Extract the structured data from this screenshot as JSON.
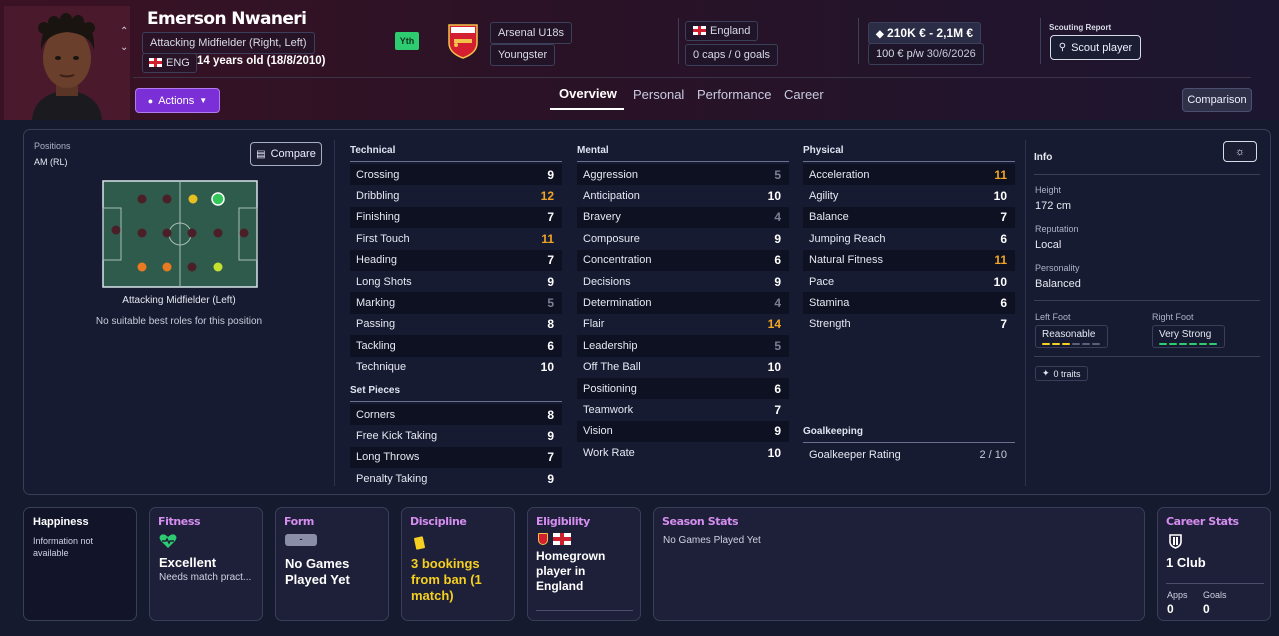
{
  "player": {
    "name": "Emerson Nwaneri",
    "position": "Attacking Midfielder (Right, Left)",
    "nation_code": "ENG",
    "age": "14 years old (18/8/2010)",
    "status_badge": "Yth",
    "club": "Arsenal U18s",
    "club_role": "Youngster",
    "nationality": "England",
    "caps": "0 caps / 0 goals",
    "value": "210K € - 2,1M €",
    "wage": "100 € p/w",
    "contract_end": "30/6/2026"
  },
  "header": {
    "scouting_report_label": "Scouting Report",
    "scout_button": "Scout player",
    "actions_button": "Actions",
    "comparison_button": "Comparison",
    "tabs": [
      "Overview",
      "Personal",
      "Performance",
      "Career"
    ]
  },
  "positions": {
    "label": "Positions",
    "code": "AM (RL)",
    "compare_button": "Compare",
    "selected_role": "Attacking Midfielder (Left)",
    "note": "No suitable best roles for this position"
  },
  "attributes": {
    "technical_title": "Technical",
    "technical": [
      {
        "name": "Crossing",
        "value": "9",
        "tone": "normal"
      },
      {
        "name": "Dribbling",
        "value": "12",
        "tone": "hi"
      },
      {
        "name": "Finishing",
        "value": "7",
        "tone": "normal"
      },
      {
        "name": "First Touch",
        "value": "11",
        "tone": "hi"
      },
      {
        "name": "Heading",
        "value": "7",
        "tone": "normal"
      },
      {
        "name": "Long Shots",
        "value": "9",
        "tone": "normal"
      },
      {
        "name": "Marking",
        "value": "5",
        "tone": "lo"
      },
      {
        "name": "Passing",
        "value": "8",
        "tone": "normal"
      },
      {
        "name": "Tackling",
        "value": "6",
        "tone": "normal"
      },
      {
        "name": "Technique",
        "value": "10",
        "tone": "normal"
      }
    ],
    "set_pieces_title": "Set Pieces",
    "set_pieces": [
      {
        "name": "Corners",
        "value": "8",
        "tone": "normal"
      },
      {
        "name": "Free Kick Taking",
        "value": "9",
        "tone": "normal"
      },
      {
        "name": "Long Throws",
        "value": "7",
        "tone": "normal"
      },
      {
        "name": "Penalty Taking",
        "value": "9",
        "tone": "normal"
      }
    ],
    "mental_title": "Mental",
    "mental": [
      {
        "name": "Aggression",
        "value": "5",
        "tone": "lo"
      },
      {
        "name": "Anticipation",
        "value": "10",
        "tone": "normal"
      },
      {
        "name": "Bravery",
        "value": "4",
        "tone": "lo"
      },
      {
        "name": "Composure",
        "value": "9",
        "tone": "normal"
      },
      {
        "name": "Concentration",
        "value": "6",
        "tone": "normal"
      },
      {
        "name": "Decisions",
        "value": "9",
        "tone": "normal"
      },
      {
        "name": "Determination",
        "value": "4",
        "tone": "lo"
      },
      {
        "name": "Flair",
        "value": "14",
        "tone": "hi"
      },
      {
        "name": "Leadership",
        "value": "5",
        "tone": "lo"
      },
      {
        "name": "Off The Ball",
        "value": "10",
        "tone": "normal"
      },
      {
        "name": "Positioning",
        "value": "6",
        "tone": "normal"
      },
      {
        "name": "Teamwork",
        "value": "7",
        "tone": "normal"
      },
      {
        "name": "Vision",
        "value": "9",
        "tone": "normal"
      },
      {
        "name": "Work Rate",
        "value": "10",
        "tone": "normal"
      }
    ],
    "physical_title": "Physical",
    "physical": [
      {
        "name": "Acceleration",
        "value": "11",
        "tone": "hi"
      },
      {
        "name": "Agility",
        "value": "10",
        "tone": "normal"
      },
      {
        "name": "Balance",
        "value": "7",
        "tone": "normal"
      },
      {
        "name": "Jumping Reach",
        "value": "6",
        "tone": "normal"
      },
      {
        "name": "Natural Fitness",
        "value": "11",
        "tone": "hi"
      },
      {
        "name": "Pace",
        "value": "10",
        "tone": "normal"
      },
      {
        "name": "Stamina",
        "value": "6",
        "tone": "normal"
      },
      {
        "name": "Strength",
        "value": "7",
        "tone": "normal"
      }
    ],
    "goalkeeping_title": "Goalkeeping",
    "goalkeeper_rating_label": "Goalkeeper Rating",
    "goalkeeper_rating": "2 / 10"
  },
  "info": {
    "title": "Info",
    "height_label": "Height",
    "height": "172 cm",
    "reputation_label": "Reputation",
    "reputation": "Local",
    "personality_label": "Personality",
    "personality": "Balanced",
    "left_foot_label": "Left Foot",
    "left_foot": "Reasonable",
    "left_foot_level": 3,
    "right_foot_label": "Right Foot",
    "right_foot": "Very Strong",
    "right_foot_level": 6,
    "foot_max": 6,
    "traits": "0 traits"
  },
  "cards": {
    "happiness_title": "Happiness",
    "happiness_text": "Information not available",
    "fitness_title": "Fitness",
    "fitness_value": "Excellent",
    "fitness_note": "Needs match pract...",
    "form_title": "Form",
    "form_value": "No Games Played Yet",
    "discipline_title": "Discipline",
    "discipline_value": "3 bookings from ban (1 match)",
    "eligibility_title": "Eligibility",
    "eligibility_value": "Homegrown player in England",
    "season_title": "Season Stats",
    "season_value": "No Games Played Yet",
    "career_title": "Career Stats",
    "career_clubs": "1 Club",
    "apps_label": "Apps",
    "apps_value": "0",
    "goals_label": "Goals",
    "goals_value": "0"
  },
  "colors": {
    "accent_purple": "#7b2fd6",
    "highlight_orange": "#f0a526",
    "low_grey": "#7c8096",
    "yth_green": "#2ecc71",
    "card_title_pink": "#d58df0"
  }
}
